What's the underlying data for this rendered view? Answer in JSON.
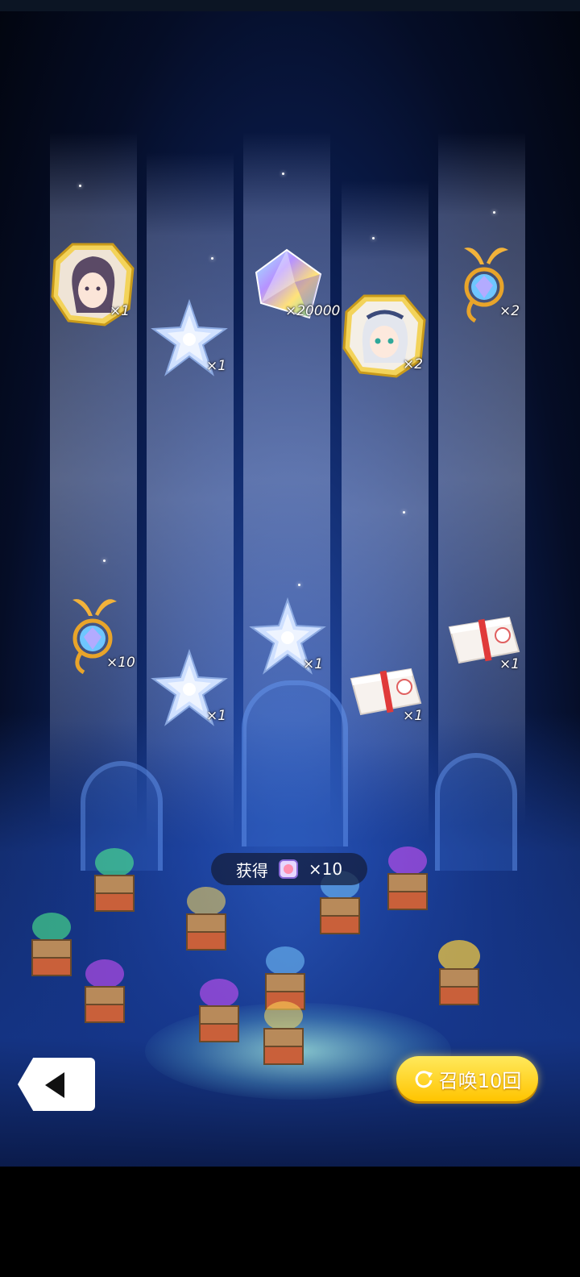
{
  "rewards": [
    {
      "kind": "character-portrait-woman",
      "qty": "×1"
    },
    {
      "kind": "crystal-star",
      "qty": "×1"
    },
    {
      "kind": "prism-gem",
      "qty": "×20000"
    },
    {
      "kind": "character-portrait-girl",
      "qty": "×2"
    },
    {
      "kind": "golden-orb-charm",
      "qty": "×2"
    },
    {
      "kind": "golden-orb-charm",
      "qty": "×10"
    },
    {
      "kind": "crystal-star",
      "qty": "×1"
    },
    {
      "kind": "crystal-star",
      "qty": "×1"
    },
    {
      "kind": "gift-box",
      "qty": "×1"
    },
    {
      "kind": "gift-box",
      "qty": "×1"
    }
  ],
  "banner": {
    "label": "获得",
    "count": "×10"
  },
  "summon_button": {
    "label": "召唤10回"
  },
  "colors": {
    "accent_yellow": "#ffd21f",
    "beam": "#c8d7ff",
    "background": "#0b1f55"
  }
}
